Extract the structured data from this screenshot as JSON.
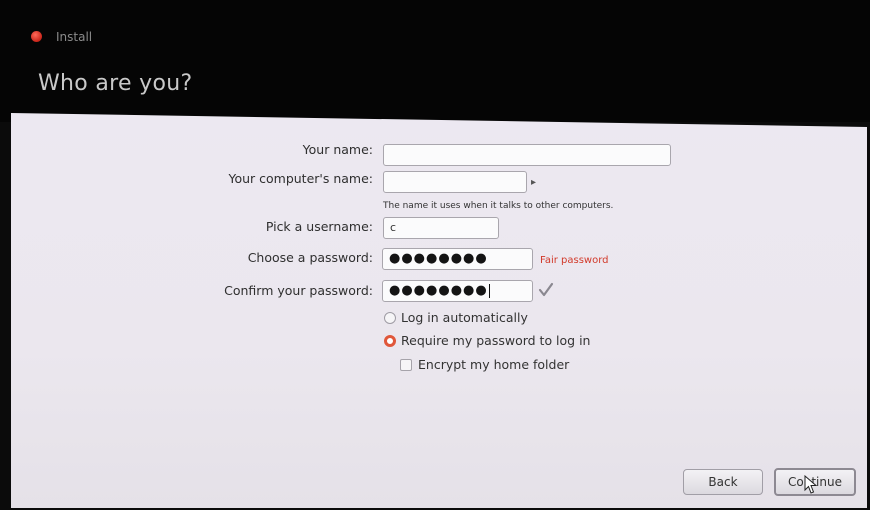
{
  "header": {
    "app_label": "Install",
    "page_title": "Who are you?"
  },
  "form": {
    "name": {
      "label": "Your name:",
      "value": ""
    },
    "computer": {
      "label": "Your computer's name:",
      "value": "",
      "hint": "The name it uses when it talks to other computers."
    },
    "username": {
      "label": "Pick a username:",
      "value": "c"
    },
    "password": {
      "label": "Choose a password:",
      "value": "●●●●●●●●",
      "strength": "Fair password",
      "strength_color": "#d23a2a"
    },
    "confirm": {
      "label": "Confirm your password:",
      "value": "●●●●●●●●"
    }
  },
  "login_options": {
    "auto": {
      "label": "Log in automatically",
      "selected": false
    },
    "require": {
      "label": "Require my password to log in",
      "selected": true
    },
    "encrypt": {
      "label": "Encrypt my home folder",
      "checked": false
    }
  },
  "buttons": {
    "back": "Back",
    "continue": "Continue"
  },
  "colors": {
    "accent": "#e0573a",
    "header_bg": "#050505",
    "content_bg": "#ece8f1"
  }
}
